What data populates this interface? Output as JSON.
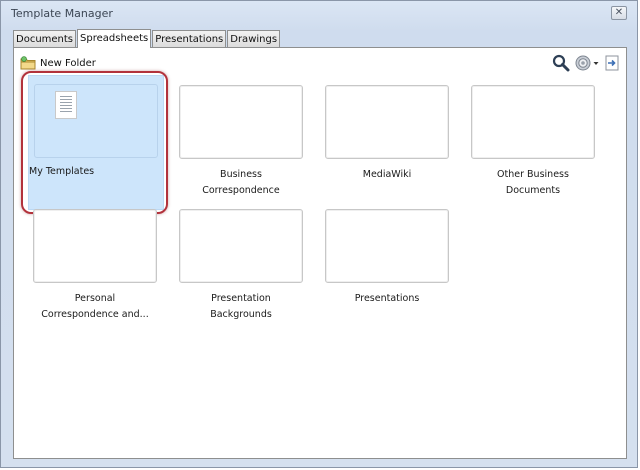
{
  "window": {
    "title": "Template Manager",
    "close_glyph": "✕"
  },
  "tabs": [
    {
      "label": "Documents",
      "active": false
    },
    {
      "label": "Spreadsheets",
      "active": true
    },
    {
      "label": "Presentations",
      "active": false
    },
    {
      "label": "Drawings",
      "active": false
    }
  ],
  "toolbar": {
    "new_folder_label": "New Folder",
    "icons": [
      "folder-icon",
      "search-icon",
      "gear-icon",
      "chevron-down-icon",
      "import-icon"
    ]
  },
  "folders": [
    {
      "line1": "My Templates",
      "line2": "",
      "selected": true
    },
    {
      "line1": "Business",
      "line2": "Correspondence",
      "selected": false
    },
    {
      "line1": "MediaWiki",
      "line2": "",
      "selected": false
    },
    {
      "line1": "Other Business",
      "line2": "Documents",
      "selected": false
    },
    {
      "line1": "Personal",
      "line2": "Correspondence and...",
      "selected": false
    },
    {
      "line1": "Presentation",
      "line2": "Backgrounds",
      "selected": false
    },
    {
      "line1": "Presentations",
      "line2": "",
      "selected": false
    }
  ],
  "colors": {
    "selection": "#cde5fb",
    "highlight_ring": "#b2323c",
    "window_bg": "#d5e0ef"
  }
}
